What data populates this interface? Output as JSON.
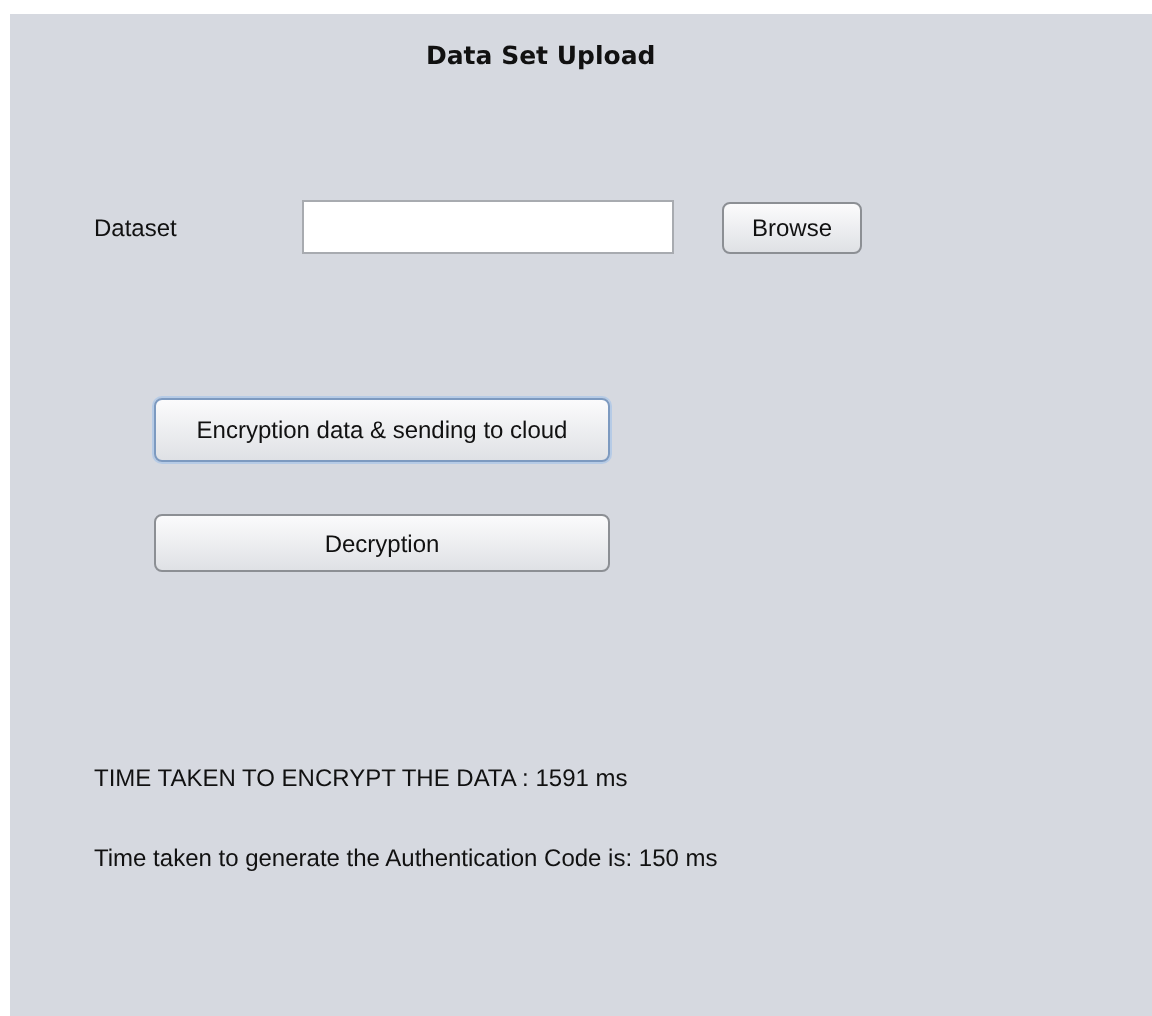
{
  "title": "Data Set Upload",
  "dataset": {
    "label": "Dataset"
  },
  "browse_button": "Browse",
  "buttons": [
    {
      "label": "Encryption data & sending to cloud",
      "focused": true
    },
    {
      "label": "Decryption",
      "focused": false
    }
  ],
  "results": [
    "TIME TAKEN TO ENCRYPT THE DATA : 1591 ms",
    "Time taken to generate the Authentication Code is: 150 ms"
  ]
}
